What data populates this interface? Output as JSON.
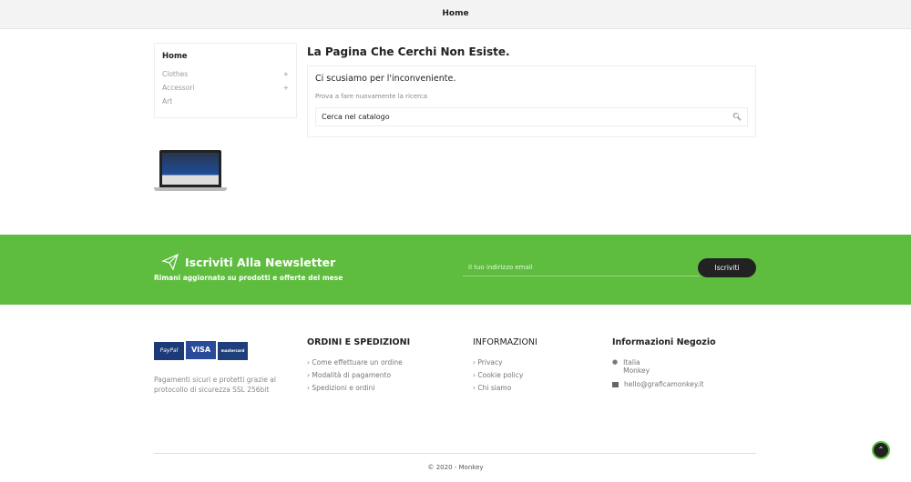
{
  "header": {
    "title": "Home"
  },
  "sidebar": {
    "title": "Home",
    "items": [
      {
        "label": "Clothes",
        "expand": "+"
      },
      {
        "label": "Accessori",
        "expand": "+"
      },
      {
        "label": "Art",
        "expand": ""
      }
    ]
  },
  "main": {
    "title": "La Pagina Che Cerchi Non Esiste.",
    "sorry": "Ci scusiamo per l'inconveniente.",
    "hint": "Prova a fare nuovamente la ricerca",
    "search_placeholder": "Cerca nel catalogo"
  },
  "newsletter": {
    "title": "Iscriviti Alla Newsletter",
    "subtitle": "Rimani aggiornato su prodotti e offerte del mese",
    "email_placeholder": "Il tuo indirizzo email",
    "button": "Iscriviti",
    "bg": "#5ebd3e"
  },
  "footer": {
    "payments": [
      "PayPal",
      "VISA",
      "mastercard"
    ],
    "payment_text": "Pagamenti sicuri e protetti grazie al protocollo di sicurezza SSL 256bit",
    "orders": {
      "title": "ORDINI E SPEDIZIONI",
      "links": [
        "› Come effettuare un ordine",
        "› Modalità di pagamento",
        "› Spedizioni e ordini"
      ]
    },
    "info": {
      "title": "INFORMAZIONI",
      "links": [
        "› Privacy",
        "› Cookie policy",
        "› Chi siamo"
      ]
    },
    "shop": {
      "title": "Informazioni Negozio",
      "address1": "Italia",
      "address2": "Monkey",
      "email": "hello@graficamonkey.it"
    },
    "copyright": "© 2020 - Monkey"
  }
}
